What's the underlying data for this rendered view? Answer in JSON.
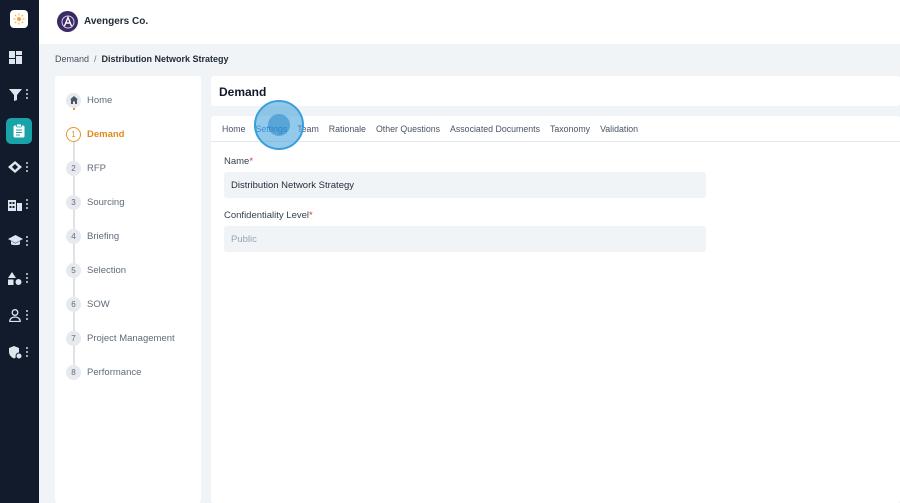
{
  "org": {
    "name": "Avengers Co."
  },
  "breadcrumb": {
    "parent": "Demand",
    "separator": "/",
    "current": "Distribution Network Strategy"
  },
  "rail": {
    "icons": [
      "app-logo-icon",
      "dashboard-icon",
      "filter-icon",
      "clipboard-icon",
      "tag-icon",
      "building-icon",
      "graduation-cap-icon",
      "shapes-icon",
      "user-icon",
      "shield-icon"
    ],
    "active_color": "#17a3a8"
  },
  "stepper": {
    "steps": [
      {
        "num": "",
        "label": "Home"
      },
      {
        "num": "1",
        "label": "Demand"
      },
      {
        "num": "2",
        "label": "RFP"
      },
      {
        "num": "3",
        "label": "Sourcing"
      },
      {
        "num": "4",
        "label": "Briefing"
      },
      {
        "num": "5",
        "label": "Selection"
      },
      {
        "num": "6",
        "label": "SOW"
      },
      {
        "num": "7",
        "label": "Project Management"
      },
      {
        "num": "8",
        "label": "Performance"
      }
    ],
    "active_color": "#e08a1b"
  },
  "page": {
    "title": "Demand"
  },
  "tabs": [
    "Home",
    "Settings",
    "Team",
    "Rationale",
    "Other Questions",
    "Associated Documents",
    "Taxonomy",
    "Validation"
  ],
  "form": {
    "name_label": "Name",
    "name_value": "Distribution Network Strategy",
    "confidentiality_label": "Confidentiality Level",
    "confidentiality_value": "Public",
    "required_mark": "*"
  }
}
